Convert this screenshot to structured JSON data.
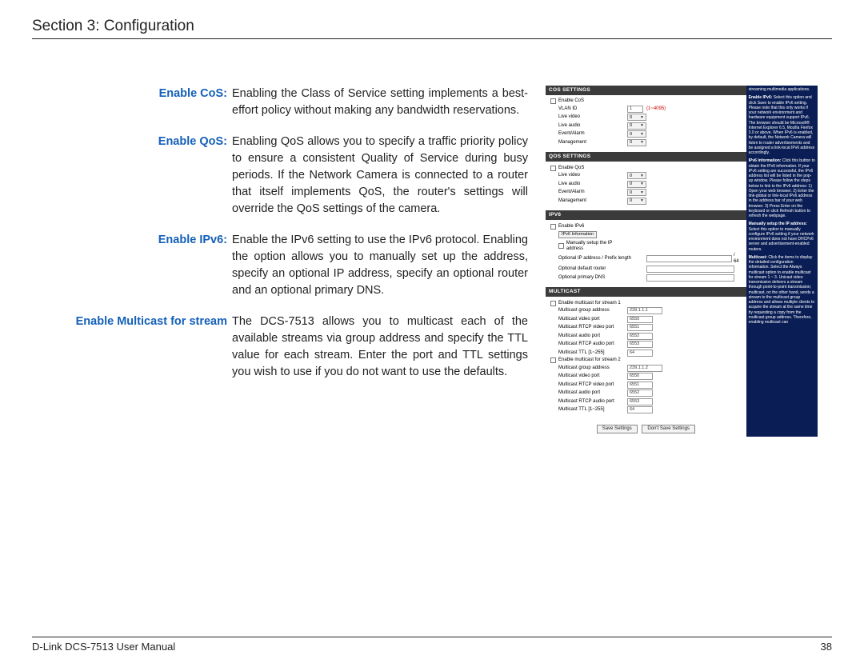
{
  "header": {
    "title": "Section 3: Configuration"
  },
  "footer": {
    "left": "D-Link DCS-7513 User Manual",
    "page": "38"
  },
  "defs": [
    {
      "term": "Enable CoS:",
      "desc": "Enabling the Class of Service setting implements a best-effort policy without making any bandwidth reservations."
    },
    {
      "term": "Enable QoS:",
      "desc": "Enabling QoS allows you to specify a traffic priority policy to ensure a consistent Quality of Service during busy periods. If the Network Camera is connected to a router that itself implements QoS, the router's settings will override the QoS settings of the camera."
    },
    {
      "term": "Enable IPv6:",
      "desc": "Enable the IPv6 setting to use the IPv6 protocol. Enabling the option allows you to manually set up the address, specify an optional IP address, specify an optional router and an optional primary DNS."
    },
    {
      "term": "Enable Multicast for stream",
      "desc": "The DCS-7513 allows you to multicast each of the available streams via group address and specify the TTL value for each stream. Enter the port and TTL settings you wish to use if you do not want to use the defaults."
    }
  ],
  "shot": {
    "cos": {
      "head": "COS SETTINGS",
      "enable": "Enable CoS",
      "vlan_label": "VLAN ID",
      "vlan_value": "1",
      "vlan_hint": "(1~4095)",
      "rows": [
        "Live video",
        "Live audio",
        "Event/Alarm",
        "Management"
      ],
      "sel": "0"
    },
    "qos": {
      "head": "QOS SETTINGS",
      "enable": "Enable QoS",
      "rows": [
        "Live video",
        "Live audio",
        "Event/Alarm",
        "Management"
      ],
      "sel": "0"
    },
    "ipv6": {
      "head": "IPV6",
      "enable": "Enable IPv6",
      "info_btn": "IPv6 Information",
      "manual": "Manually setup the IP address",
      "opt_ip": "Optional IP address / Prefix length",
      "opt_ip_suffix": "/ 64",
      "opt_router": "Optional default router",
      "opt_dns": "Optional primary DNS"
    },
    "mc": {
      "head": "MULTICAST",
      "en1": "Enable multicast for stream 1",
      "en2": "Enable multicast for stream 2",
      "grp": "Multicast group address",
      "grp_v1": "239.1.1.1",
      "grp_v2": "239.1.1.2",
      "vp": "Multicast video port",
      "vp_v": "6550",
      "rvp": "Multicast RTCP video port",
      "rvp_v": "6551",
      "ap": "Multicast audio port",
      "ap_v": "6552",
      "rap": "Multicast RTCP audio port",
      "rap_v": "6553",
      "ttl": "Multicast TTL [1~255]",
      "ttl_v": "64"
    },
    "btns": {
      "save": "Save Settings",
      "dont": "Don't Save Settings"
    },
    "side": {
      "p1": "streaming multimedia applications.",
      "h2": "Enable IPv6:",
      "p2": "Select this option and click Save to enable IPv6 setting. Please note that this only works if your network environment and hardware equipment support IPv6. The browser should be Microsoft® Internet Explorer 6.5, Mozilla Firefox 3.0 or above. When IPv6 is enabled, by default, the Network Camera will listen to router advertisements and be assigned a link-local IPv6 address accordingly.",
      "h3": "IPv6 Information:",
      "p3": "Click this button to obtain the IPv6 information. If your IPv6 setting are successful, the IPv6 address list will be listed in the pop-up window. Please follow the steps below to link to the IPv6 address: 1) Open your web browser. 2) Enter the link-global or link-local IPv6 address in the address bar of your web browser. 3) Press Enter on the keyboard or click Refresh button to refresh the webpage.",
      "h4": "Manually setup the IP address:",
      "p4": "Select this option to manually configure IPv6 setting if your network environment does not have DHCPv6 server and advertisement-enabled routers.",
      "h5": "Multicast:",
      "p5": "Click the items to display the detailed configuration information. Select the Always multicast option to enable multicast for stream 1 ~ 3. Unicast video transmission delivers a stream through point-to-point transmission; multicast, on the other hand, sends a stream to the multicast group address and allows multiple clients to acquire the stream at the same time by requesting a copy from the multicast group address. Therefore, enabling multicast can"
    }
  }
}
